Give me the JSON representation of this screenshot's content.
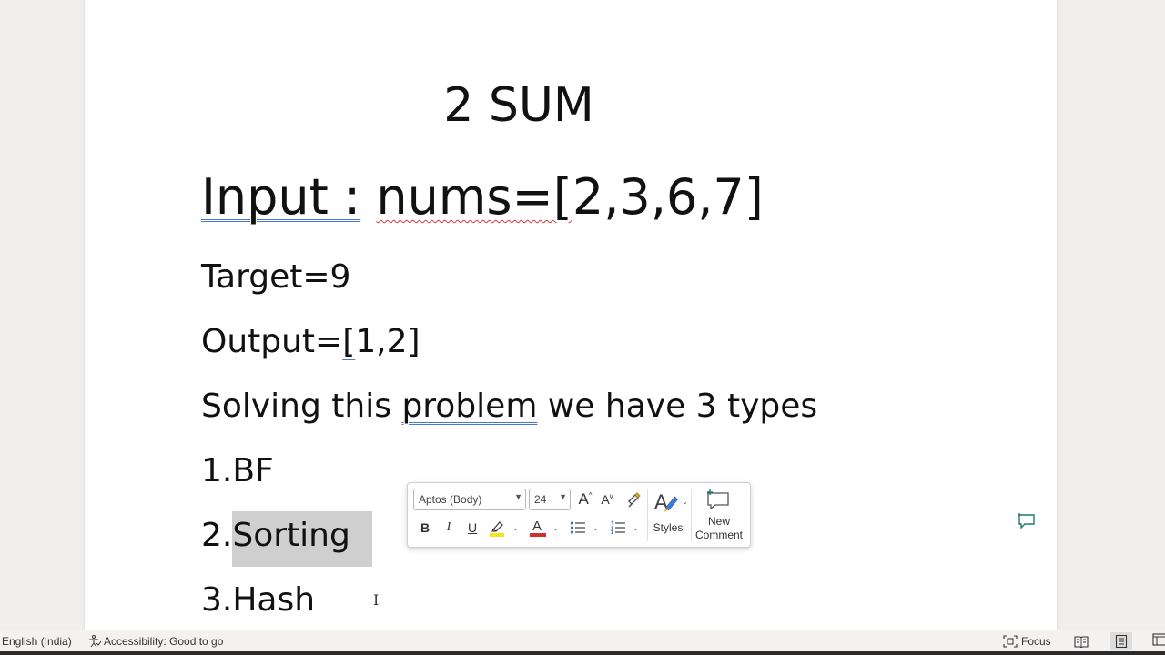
{
  "document": {
    "title": "2 SUM",
    "input_label": "Input :",
    "input_nums": "nums=[",
    "input_values": "2,3,6,7]",
    "target": "Target=9",
    "output_prefix": "Output=",
    "output_bracket": "[",
    "output_values": "1,2]",
    "solving_start": "Solving this ",
    "solving_word": "problem",
    "solving_end": " we have 3 types",
    "item1": "1.BF",
    "item2_number": "2.",
    "item2_text": "Sorting",
    "item3": "3.Hash"
  },
  "mini_toolbar": {
    "font_name": "Aptos (Body)",
    "font_size": "24",
    "grow_font": "A",
    "shrink_font": "A",
    "bold": "B",
    "italic": "I",
    "underline": "U",
    "font_color_letter": "A",
    "styles_label": "Styles",
    "new_comment_line1": "New",
    "new_comment_line2": "Comment",
    "highlight_color": "#f5e51e",
    "font_color": "#d0312d"
  },
  "status_bar": {
    "language": "English (India)",
    "accessibility": "Accessibility: Good to go",
    "focus": "Focus"
  },
  "icons": [
    "grow-font-icon",
    "shrink-font-icon",
    "format-painter-icon",
    "highlight-icon",
    "font-color-icon",
    "bullets-icon",
    "numbering-icon",
    "styles-icon",
    "new-comment-icon",
    "accessibility-icon",
    "focus-icon",
    "read-mode-icon",
    "print-layout-icon",
    "web-layout-icon",
    "add-comment-icon"
  ]
}
